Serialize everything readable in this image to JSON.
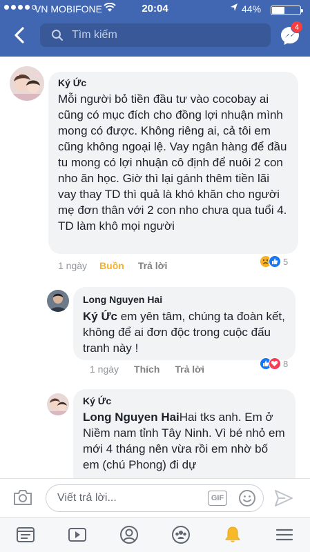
{
  "status_bar": {
    "carrier": "VN MOBIFONE",
    "time": "20:04",
    "battery_text": "44%",
    "battery_level": 0.44
  },
  "header": {
    "search_placeholder": "Tìm kiếm",
    "messenger_badge": "4"
  },
  "comments": [
    {
      "author": "Ký Ức",
      "text": "Mỗi người bỏ tiền đầu tư vào cocobay ai cũng có mục đích cho đồng lợi nhuận mình mong có được. Không riêng ai, cả tôi em cũng không ngoại lệ. Vay ngân hàng để đầu tu mong có lợi nhuận cô định để nuôi 2 con nho ăn học. Giờ thì lại gánh thêm tiền lãi vay thay TD thì quả là khó khăn cho người mẹ đơn thân với 2 con nho chưa qua tuổi 4. TD làm khô mọi người",
      "time": "1 ngày",
      "reaction_label": "Buồn",
      "reply_label": "Trả lời",
      "reaction_count": "5"
    },
    {
      "author": "Long Nguyen Hai",
      "mention": "Ký Ức",
      "text": " em yên tâm, chúng ta đoàn kết, không để ai đơn độc trong cuộc đấu tranh này !",
      "time": "1 ngày",
      "like_label": "Thích",
      "reply_label": "Trả lời",
      "reaction_count": "8"
    },
    {
      "author": "Ký Ức",
      "mention": "Long Nguyen Hai",
      "text": "Hai tks anh. Em ở Niềm nam tỉnh Tây Ninh. Vì bé nhỏ em mới 4 tháng nên vừa rồi em nhờ bố em (chú Phong) đi dự"
    }
  ],
  "composer": {
    "placeholder": "Viết trả lời...",
    "gif_label": "GIF"
  },
  "tabs": [
    "feed-icon",
    "watch-icon",
    "profile-icon",
    "groups-icon",
    "notifications-icon",
    "menu-icon"
  ],
  "colors": {
    "brand": "#4267b2",
    "bubble": "#f2f3f5",
    "sad_reaction": "#f7b125",
    "muted": "#90949c"
  }
}
